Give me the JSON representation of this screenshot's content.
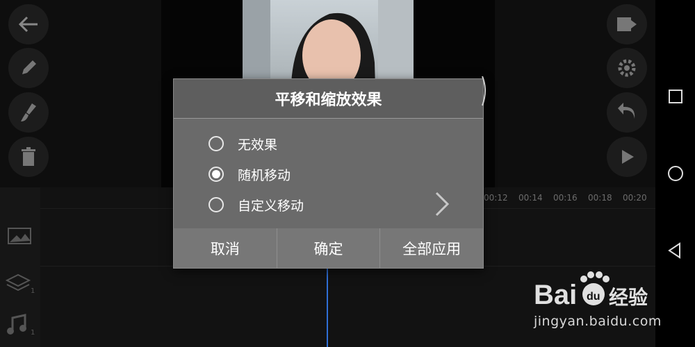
{
  "dialog": {
    "title": "平移和缩放效果",
    "options": [
      {
        "label": "无效果",
        "selected": false
      },
      {
        "label": "随机移动",
        "selected": true
      },
      {
        "label": "自定义移动",
        "selected": false
      }
    ],
    "buttons": {
      "cancel": "取消",
      "confirm": "确定",
      "apply_all": "全部应用"
    }
  },
  "timeline": {
    "ticks": [
      "00:12",
      "00:14",
      "00:16",
      "00:18",
      "00:20"
    ],
    "track_badges": {
      "layers": "1",
      "music": "1"
    }
  },
  "left_toolbar": [
    "back-arrow-icon",
    "pencil-icon",
    "brush-icon",
    "trash-icon"
  ],
  "right_toolbar": [
    "export-film-icon",
    "gear-icon",
    "undo-icon",
    "play-icon"
  ],
  "watermark": {
    "brand": "Bai du 经验",
    "url": "jingyan.baidu.com"
  },
  "colors": {
    "dialog_bg": "#6f6f6f",
    "dialog_title_bg": "#5e5e5e",
    "playhead": "#2f6fd6"
  }
}
